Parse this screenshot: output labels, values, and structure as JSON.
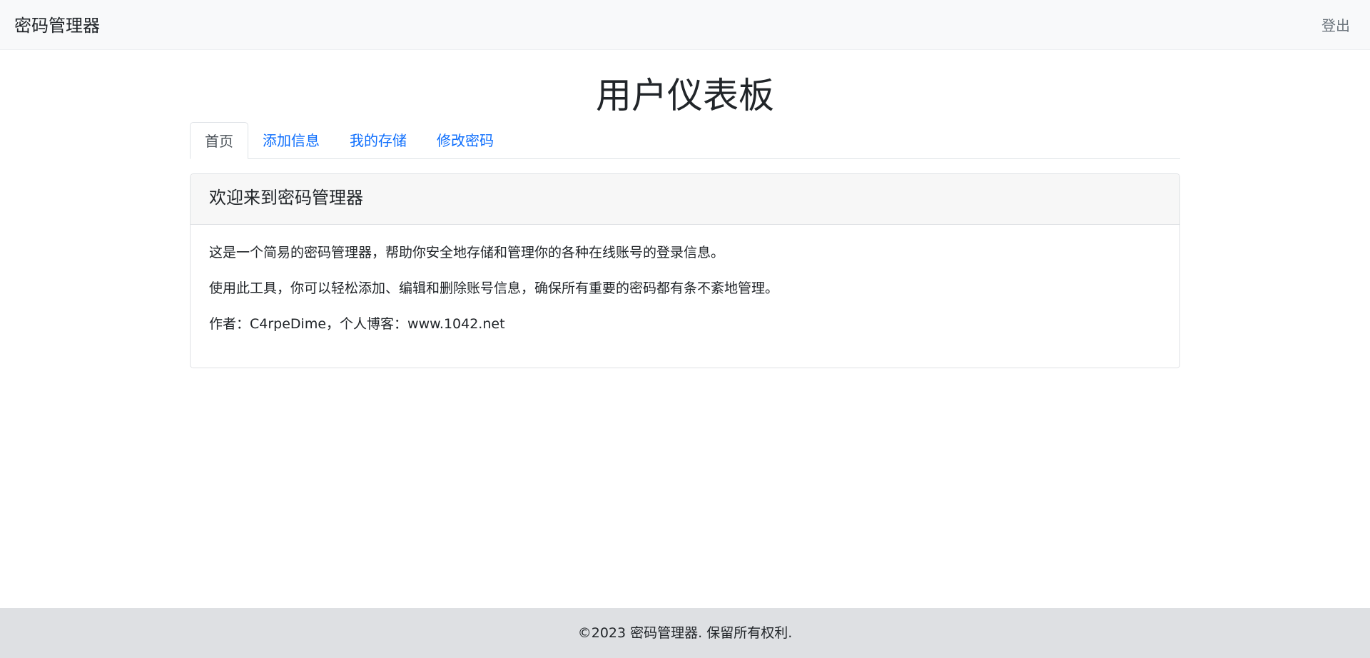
{
  "navbar": {
    "brand": "密码管理器",
    "logout_label": "登出"
  },
  "page": {
    "title": "用户仪表板"
  },
  "tabs": [
    {
      "label": "首页",
      "active": true
    },
    {
      "label": "添加信息",
      "active": false
    },
    {
      "label": "我的存储",
      "active": false
    },
    {
      "label": "修改密码",
      "active": false
    }
  ],
  "card": {
    "header": "欢迎来到密码管理器",
    "paragraphs": [
      "这是一个简易的密码管理器，帮助你安全地存储和管理你的各种在线账号的登录信息。",
      "使用此工具，你可以轻松添加、编辑和删除账号信息，确保所有重要的密码都有条不紊地管理。",
      "作者：C4rpeDime，个人博客：www.1042.net"
    ]
  },
  "footer": {
    "text": "©2023 密码管理器. 保留所有权利."
  },
  "colors": {
    "link": "#0d6efd",
    "navbar_bg": "#f8f9fa",
    "footer_bg": "#dee0e3",
    "text": "#212529",
    "muted": "#6c757d"
  }
}
